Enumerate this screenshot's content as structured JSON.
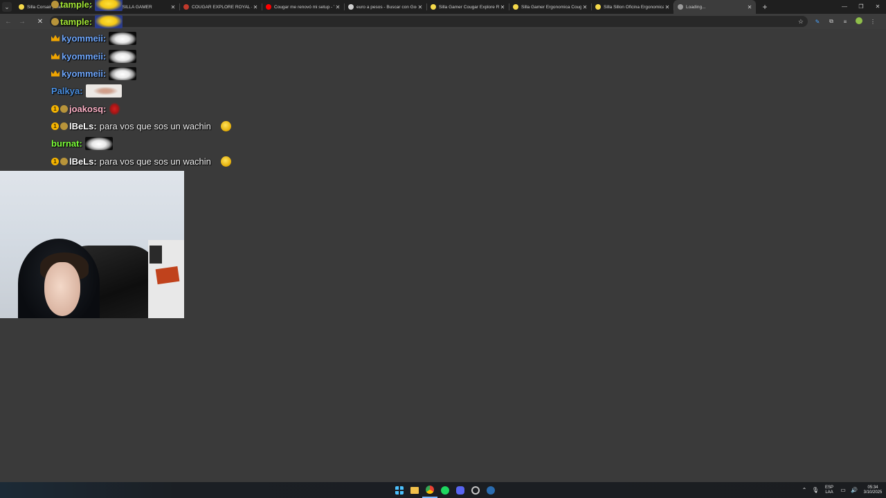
{
  "tabs": [
    {
      "title": "Silla Corsair | MercadoLibre",
      "favicon_color": "#f5d94a",
      "active": false
    },
    {
      "title": "PARA SILLA GAMER",
      "favicon_color": "#f5d94a",
      "active": false
    },
    {
      "title": "COUGAR EXPLORE ROYAL - Ga",
      "favicon_color": "#c0392b",
      "active": false
    },
    {
      "title": "Cougar me renovó mi setup - Y",
      "favicon_color": "#ff0000",
      "active": false
    },
    {
      "title": "euro a pesos - Buscar con Goo",
      "favicon_color": "#d0d0d0",
      "active": false
    },
    {
      "title": "Silla Gamer Cougar Explore Ro",
      "favicon_color": "#f5d94a",
      "active": false
    },
    {
      "title": "Silla Gamer Ergonomica Cougar",
      "favicon_color": "#f5d94a",
      "active": false
    },
    {
      "title": "Silla Sillon Oficina Ergonomica",
      "favicon_color": "#f5d94a",
      "active": false
    },
    {
      "title": "Loading...",
      "favicon_color": "#9a9a9a",
      "active": true
    }
  ],
  "toolbar": {
    "back_icon": "back-arrow-icon",
    "forward_icon": "forward-arrow-icon",
    "stop_icon": "close-icon",
    "bookmark_icon": "star-icon"
  },
  "chat": {
    "messages": [
      {
        "user": "tample",
        "color": "#a3e635",
        "badges": [
          "coin"
        ],
        "emote": "minion",
        "text": ""
      },
      {
        "user": "tample",
        "color": "#a3e635",
        "badges": [
          "coin"
        ],
        "emote": "minion",
        "text": ""
      },
      {
        "user": "kyommeii",
        "color": "#6fa8ff",
        "badges": [
          "crown"
        ],
        "emote": "ghost",
        "text": ""
      },
      {
        "user": "kyommeii",
        "color": "#6fa8ff",
        "badges": [
          "crown"
        ],
        "emote": "ghost",
        "text": ""
      },
      {
        "user": "kyommeii",
        "color": "#6fa8ff",
        "badges": [
          "crown"
        ],
        "emote": "ghost",
        "text": ""
      },
      {
        "user": "Palkya",
        "color": "#4a90e2",
        "badges": [],
        "emote": "baby",
        "text": ""
      },
      {
        "user": "joakosq",
        "color": "#ffb3c8",
        "badges": [
          "gold",
          "coin"
        ],
        "emote": "lips",
        "text": ""
      },
      {
        "user": "lBeLs",
        "color": "#ffffff",
        "badges": [
          "gold",
          "coin"
        ],
        "emote": "smile",
        "text": "para vos que sos un wachin"
      },
      {
        "user": "burnat",
        "color": "#7dff3a",
        "badges": [],
        "emote": "ghost",
        "text": ""
      },
      {
        "user": "lBeLs",
        "color": "#ffffff",
        "badges": [
          "gold",
          "coin"
        ],
        "emote": "smile",
        "text": "para vos que sos un wachin"
      }
    ]
  },
  "taskbar": {
    "apps": [
      "start-icon",
      "file-explorer-icon",
      "chrome-icon",
      "spotify-icon",
      "discord-icon",
      "settings-icon",
      "steam-icon"
    ],
    "lang_top": "ESP",
    "lang_bottom": "LAA",
    "time": "05:34",
    "date": "3/10/2025"
  }
}
